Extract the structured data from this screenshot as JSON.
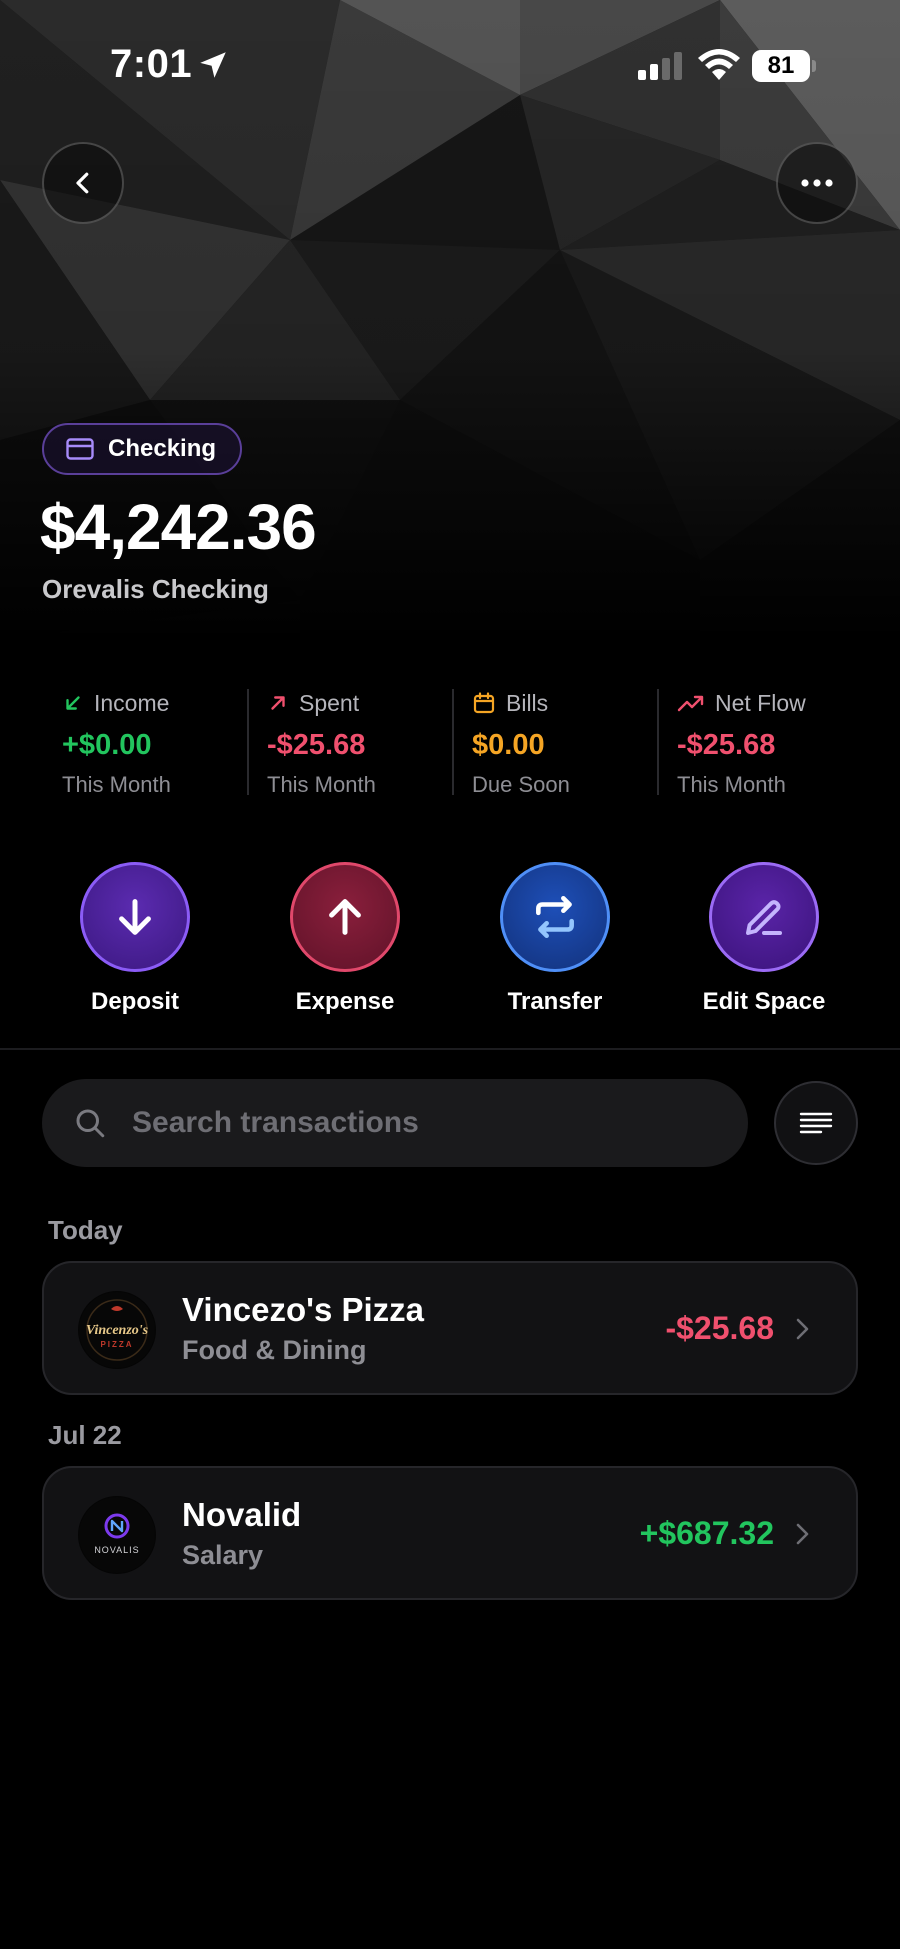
{
  "status": {
    "time": "7:01",
    "battery": "81"
  },
  "account": {
    "type_label": "Checking",
    "balance": "$4,242.36",
    "name": "Orevalis Checking"
  },
  "stats": [
    {
      "label": "Income",
      "value": "+$0.00",
      "sub": "This Month",
      "color": "#22c55e"
    },
    {
      "label": "Spent",
      "value": "-$25.68",
      "sub": "This Month",
      "color": "#f0506e"
    },
    {
      "label": "Bills",
      "value": "$0.00",
      "sub": "Due Soon",
      "color": "#f5a524"
    },
    {
      "label": "Net Flow",
      "value": "-$25.68",
      "sub": "This Month",
      "color": "#f0506e"
    }
  ],
  "actions": {
    "deposit": "Deposit",
    "expense": "Expense",
    "transfer": "Transfer",
    "edit_space": "Edit Space"
  },
  "search": {
    "placeholder": "Search transactions"
  },
  "groups": [
    {
      "date": "Today",
      "transactions": [
        {
          "name": "Vincezo's Pizza",
          "category": "Food & Dining",
          "amount": "-$25.68",
          "color": "#f0506e",
          "logo_text": "Vincenzo's",
          "logo_sub": "PIZZA"
        }
      ]
    },
    {
      "date": "Jul 22",
      "transactions": [
        {
          "name": "Novalid",
          "category": "Salary",
          "amount": "+$687.32",
          "color": "#22c55e",
          "logo_text": "NOVALIS"
        }
      ]
    }
  ],
  "colors": {
    "accent_purple": "#7c3aed",
    "expense_red": "#9f1f3f",
    "transfer_blue": "#1d4ed8",
    "income_green": "#22c55e",
    "spent_red": "#f0506e",
    "bills_orange": "#f5a524"
  }
}
